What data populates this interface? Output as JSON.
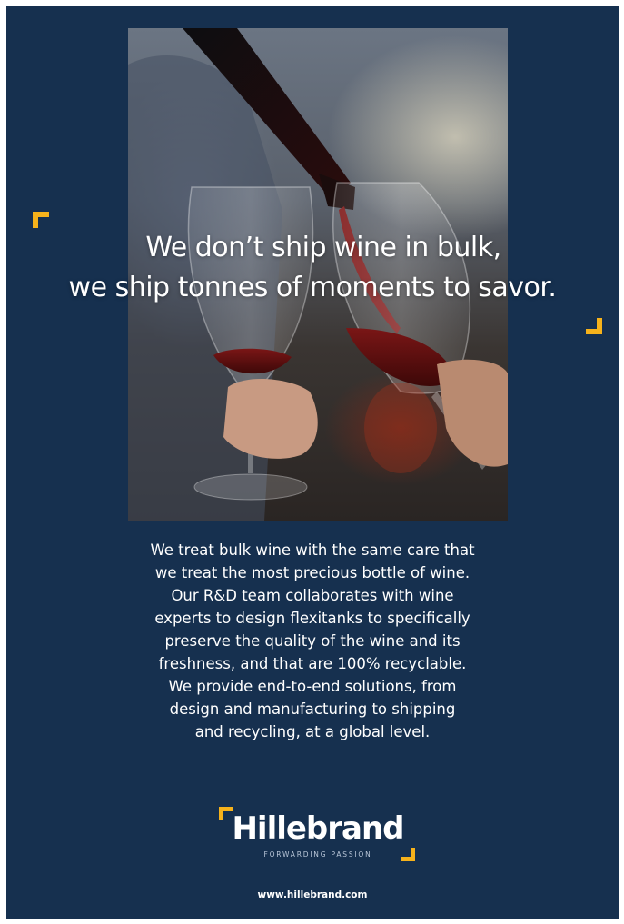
{
  "headline": {
    "line1": "We don’t ship wine in bulk,",
    "line2": "we ship tonnes of moments to savor."
  },
  "body": {
    "lines": [
      "We treat bulk wine with the same care that",
      "we treat the most precious bottle of wine.",
      "Our R&D team collaborates with wine",
      "experts to design flexitanks to specifically",
      "preserve the quality of the wine and its",
      "freshness, and that are 100% recyclable.",
      "We provide end-to-end solutions, from",
      "design and manufacturing to shipping",
      "and recycling, at a global level."
    ]
  },
  "logo": {
    "wordmark": "Hillebrand",
    "tagline": "FORWARDING PASSION"
  },
  "footer": {
    "website": "www.hillebrand.com"
  },
  "colors": {
    "background": "#16304f",
    "accent": "#f6b21b",
    "text": "#ffffff"
  },
  "icons": {
    "corner_brackets": "corner-bracket-icon"
  }
}
